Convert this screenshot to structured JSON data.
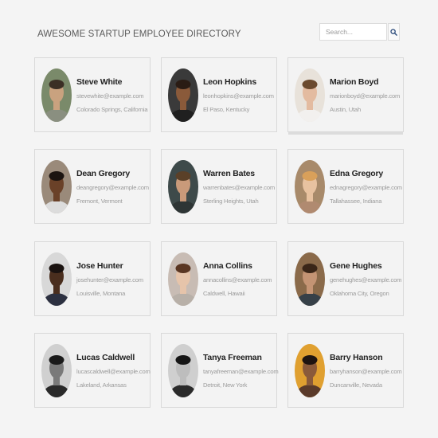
{
  "header": {
    "title": "AWESOME STARTUP EMPLOYEE DIRECTORY",
    "search_placeholder": "Search...",
    "search_icon": "search-icon"
  },
  "employees": [
    {
      "name": "Steve White",
      "email": "stevewhite@example.com",
      "location": "Colorado Springs, California",
      "avatar_bg": "#7a8a6a",
      "skin": "#c9a27f",
      "hair": "#3b2f25",
      "shirt": "#8a8f80"
    },
    {
      "name": "Leon Hopkins",
      "email": "leonhopkins@example.com",
      "location": "El Paso, Kentucky",
      "avatar_bg": "#3a3a3a",
      "skin": "#8a5a3a",
      "hair": "#2a1c14",
      "shirt": "#202020"
    },
    {
      "name": "Marion Boyd",
      "email": "marionboyd@example.com",
      "location": "Austin, Utah",
      "avatar_bg": "#e8e2da",
      "skin": "#e3bba0",
      "hair": "#6b4a2e",
      "shirt": "#f2f0ee"
    },
    {
      "name": "Dean Gregory",
      "email": "deangregory@example.com",
      "location": "Fremont, Vermont",
      "avatar_bg": "#9a8a7a",
      "skin": "#6a4128",
      "hair": "#1c1410",
      "shirt": "#dcdcdc"
    },
    {
      "name": "Warren Bates",
      "email": "warrenbates@example.com",
      "location": "Sterling Heights, Utah",
      "avatar_bg": "#3e4a4a",
      "skin": "#c99a7a",
      "hair": "#5a4028",
      "shirt": "#2e3535"
    },
    {
      "name": "Edna Gregory",
      "email": "ednagregory@example.com",
      "location": "Tallahassee, Indiana",
      "avatar_bg": "#a88a6a",
      "skin": "#e8c2a0",
      "hair": "#d9a05a",
      "shirt": "#b08a70"
    },
    {
      "name": "Jose Hunter",
      "email": "josehunter@example.com",
      "location": "Louisville, Montana",
      "avatar_bg": "#d8d8d8",
      "skin": "#4a2e1e",
      "hair": "#1a1210",
      "shirt": "#2c3040"
    },
    {
      "name": "Anna Collins",
      "email": "annacollins@example.com",
      "location": "Caldwell, Hawaii",
      "avatar_bg": "#c8bcb4",
      "skin": "#e6c4aa",
      "hair": "#5a3622",
      "shirt": "#b8b0a8"
    },
    {
      "name": "Gene Hughes",
      "email": "genehughes@example.com",
      "location": "Oklahoma City, Oregon",
      "avatar_bg": "#8a6a4a",
      "skin": "#c49474",
      "hair": "#3a2618",
      "shirt": "#364048"
    },
    {
      "name": "Lucas Caldwell",
      "email": "lucascaldwell@example.com",
      "location": "Lakeland, Arkansas",
      "avatar_bg": "#d0d0d0",
      "skin": "#7a7a7a",
      "hair": "#1a1a1a",
      "shirt": "#2a2a2a"
    },
    {
      "name": "Tanya Freeman",
      "email": "tanyafreeman@example.com",
      "location": "Detroit, New York",
      "avatar_bg": "#cfcfcf",
      "skin": "#bdbdbd",
      "hair": "#151515",
      "shirt": "#2a2a2a"
    },
    {
      "name": "Barry Hanson",
      "email": "barryhanson@example.com",
      "location": "Duncanville, Nevada",
      "avatar_bg": "#e0a030",
      "skin": "#8a5a3a",
      "hair": "#1e1410",
      "shirt": "#5a3a2a"
    }
  ]
}
